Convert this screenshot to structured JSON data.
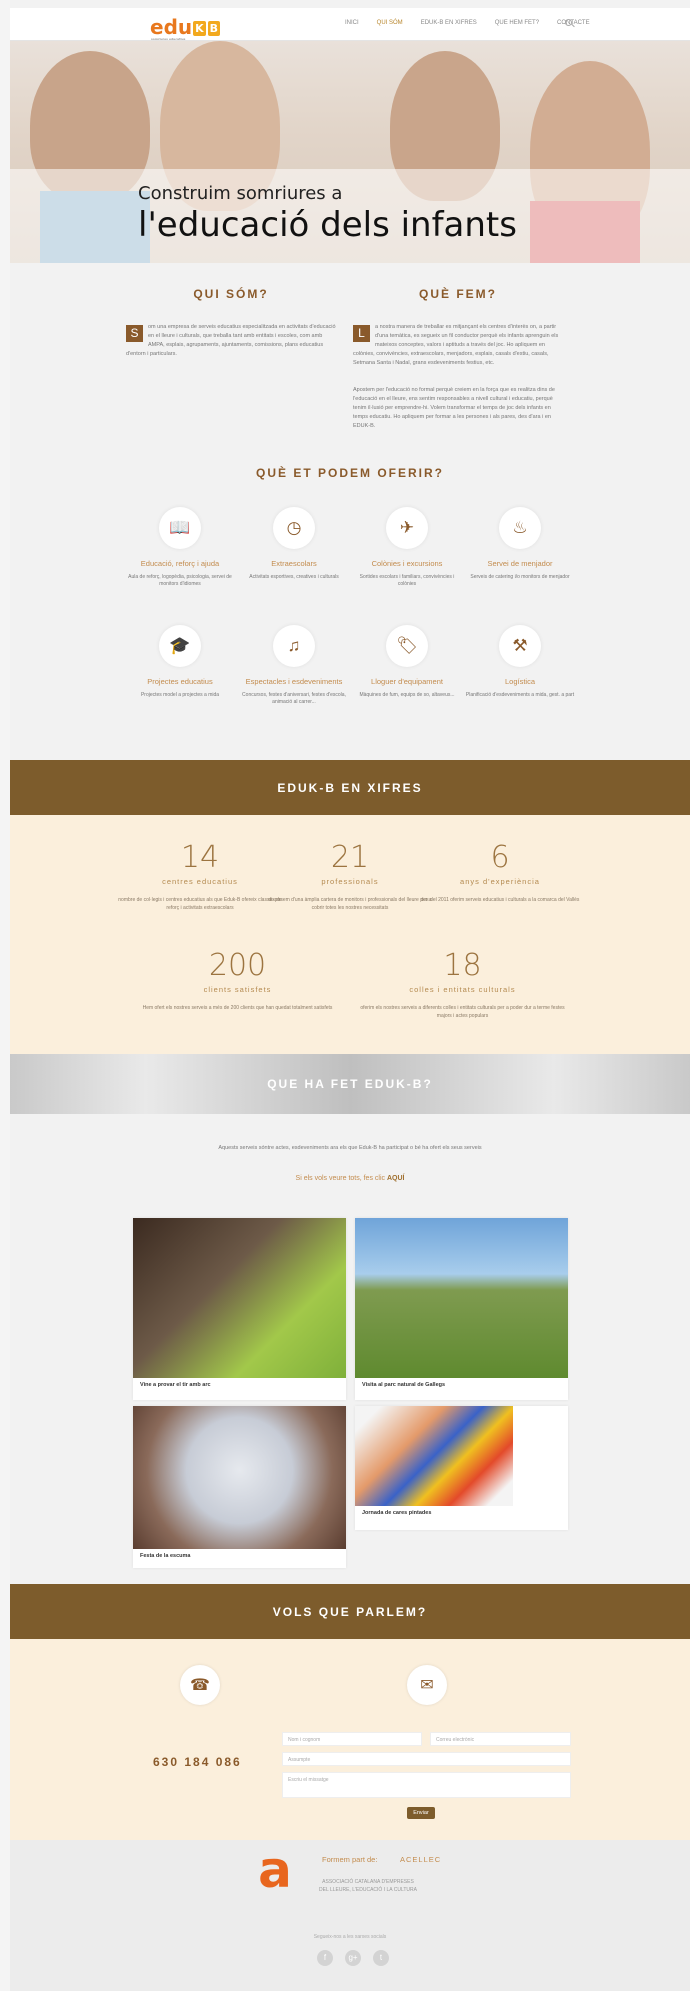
{
  "header": {
    "logo_text": "edu",
    "logo_letters": [
      "K",
      "B"
    ],
    "logo_tagline": "somriures educatius",
    "menu": [
      "INICI",
      "QUI SÓM",
      "EDUK-B EN XIFRES",
      "QUE HEM FET?",
      "CONTACTE"
    ],
    "active_menu": "QUI SÓM"
  },
  "hero": {
    "title_small": "Construim somriures a",
    "title_large": "l'educació dels infants"
  },
  "qui_som": {
    "title": "QUI SÓM?",
    "dropcap": "S",
    "text": "om una empresa de serveis educatius especialitzada en activitats d'educació en el lleure i culturals, que treballa tant amb entitats i escoles, com amb AMPA, esplais, agrupaments, ajuntaments, comissions, plans educatius d'entorn i particulars."
  },
  "que_fem": {
    "title": "QUÈ FEM?",
    "dropcap": "L",
    "text1": "a nostra manera de treballar es mitjançant els centres d'interès on, a partir d'una temàtica, es segueix un fil conductor perquè els infants aprenguin els mateixos conceptes, valors i aptituds a través del joc. Ho apliquem en colònies, convivències, extraescolars, menjadors, esplais, casals d'estiu, casals, Setmana Santa i Nadal, grans esdeveniments festius, etc.",
    "text2": "Apostem per l'educació no formal perquè creiem en la força que es realitza dins de l'educació en el lleure, ens sentim responsables a nivell cultural i educatiu, perquè tenim il·lusió per emprendre-hi. Volem transformar el temps de joc dels infants en temps educatiu. Ho apliquem per formar a les persones i als pares, des d'ara i en EDUK-B."
  },
  "oferir": {
    "title": "QUÈ ET PODEM OFERIR?",
    "services": [
      {
        "icon": "book-icon",
        "glyph": "📖",
        "title": "Educació, reforç i ajuda",
        "desc": "Aula de reforç, logopèdia, psicologia, servei de monitors d'idiomes"
      },
      {
        "icon": "clock-icon",
        "glyph": "◷",
        "title": "Extraescolars",
        "desc": "Activitats esportives, creatives i culturals"
      },
      {
        "icon": "paper-plane-icon",
        "glyph": "✈",
        "title": "Colònies i excursions",
        "desc": "Sortides escolars i familiars, convivències i colònies"
      },
      {
        "icon": "dish-icon",
        "glyph": "♨",
        "title": "Servei de menjador",
        "desc": "Serveis de catering i/o monitors de menjador"
      },
      {
        "icon": "graduation-cap-icon",
        "glyph": "🎓",
        "title": "Projectes educatius",
        "desc": "Projectes model a projectes a mida"
      },
      {
        "icon": "music-icon",
        "glyph": "♫",
        "title": "Espectacles i esdeveniments",
        "desc": "Concursos, festes d'aniversari, festes d'escola, animació al carrer..."
      },
      {
        "icon": "tag-icon",
        "glyph": "🏷",
        "title": "Lloguer d'equipament",
        "desc": "Màquines de fum, equips de so, altaveus..."
      },
      {
        "icon": "tools-icon",
        "glyph": "⚒",
        "title": "Logística",
        "desc": "Planificació d'esdeveniments a mida, gest. a part"
      }
    ]
  },
  "xifres": {
    "title": "EDUK-B EN XIFRES",
    "items": [
      {
        "number": "14",
        "label": "centres educatius",
        "desc": "nombre de col·legis i centres educatius als que Eduk-B ofereix classes de reforç i activitats extraescolars"
      },
      {
        "number": "21",
        "label": "professionals",
        "desc": "disposem d'una àmplia cartera de monitors i professionals del lleure per a cobrir totes les nostres necessitats"
      },
      {
        "number": "6",
        "label": "anys d'experiència",
        "desc": "des del 2011 oferim serveis educatius i culturals a la comarca del Vallès"
      },
      {
        "number": "200",
        "label": "clients satisfets",
        "desc": "Hem ofert els nostres serveis a més de 200 clients que han quedat totalment satisfets"
      },
      {
        "number": "18",
        "label": "colles i entitats culturals",
        "desc": "oferim els nostres serveis a diferents colles i entitats culturals per a poder dur a terme festes majors i actes populars"
      }
    ]
  },
  "fet": {
    "title": "QUE HA FET EDUK-B?",
    "intro": "Aquests serveis sóntre actes, esdeveniments ara els que Eduk-B ha participat o bé ha ofert els seus serveis",
    "cta_text": "Si els vols veure tots, fes clic",
    "cta_link": "AQUÍ",
    "cards": [
      "Vine a provar el tir amb arc",
      "Visita al parc natural de Gallegs",
      "Festa de la escuma",
      "Jornada de cares pintades"
    ]
  },
  "parlem": {
    "title": "VOLS QUE PARLEM?",
    "phone": "630 184 086",
    "fields": {
      "name": "Nom i cognom",
      "email": "Correu electrònic",
      "subject": "Assumpte",
      "message": "Escriu el missatge"
    },
    "submit": "Enviar"
  },
  "footer": {
    "member_text": "Formem part de:",
    "member_org": "ACELLEC",
    "org_logo": "a",
    "org_desc": "ASSOCIACIÓ CATALANA D'EMPRESES DEL LLEURE, L'EDUCACIÓ I LA CULTURA",
    "social_text": "Segueix-nos a les xarxes socials",
    "social": [
      {
        "icon": "facebook-icon",
        "glyph": "f"
      },
      {
        "icon": "google-plus-icon",
        "glyph": "g+"
      },
      {
        "icon": "twitter-icon",
        "glyph": "t"
      }
    ]
  }
}
